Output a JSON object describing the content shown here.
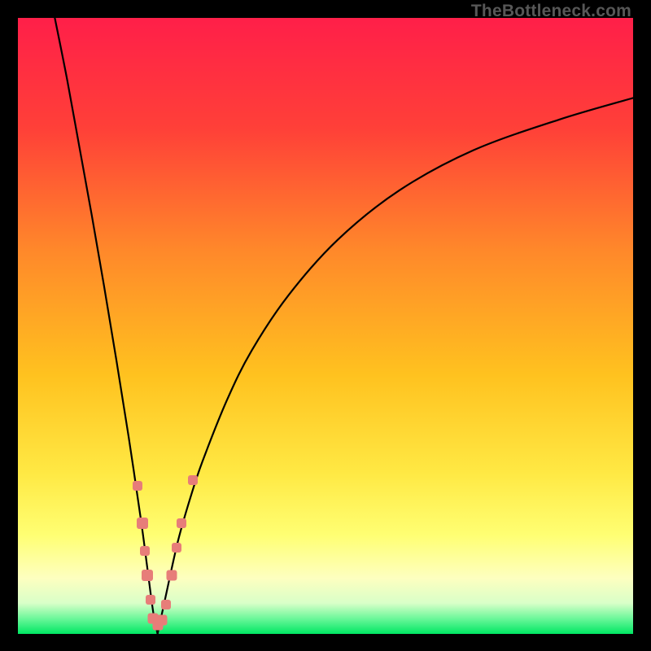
{
  "attribution": "TheBottleneck.com",
  "colors": {
    "top": "#ff1f49",
    "upper_mid": "#ff6a2a",
    "mid": "#ffcf1f",
    "lower_mid": "#ffff73",
    "pale": "#fbffd0",
    "green": "#00e763",
    "marker": "#e77d79",
    "curve": "#000000"
  },
  "chart_data": {
    "type": "line",
    "title": "",
    "xlabel": "",
    "ylabel": "",
    "xlim": [
      0,
      100
    ],
    "ylim": [
      0,
      100
    ],
    "series": [
      {
        "name": "left-curve",
        "x": [
          6,
          8,
          10,
          12,
          14,
          16,
          18,
          20,
          21,
          22,
          22.7
        ],
        "values": [
          100,
          90,
          79,
          68,
          56.5,
          44.5,
          32,
          18.5,
          11,
          3.5,
          0
        ]
      },
      {
        "name": "right-curve",
        "x": [
          22.7,
          24,
          26,
          28,
          30,
          34,
          38,
          44,
          52,
          62,
          74,
          88,
          100
        ],
        "values": [
          0,
          6,
          15,
          22,
          28,
          38,
          46,
          55,
          64,
          72,
          78.5,
          83.5,
          87
        ]
      }
    ],
    "markers": [
      {
        "x": 19.5,
        "y": 24,
        "size": 12
      },
      {
        "x": 20.2,
        "y": 18,
        "size": 14
      },
      {
        "x": 20.7,
        "y": 13.5,
        "size": 12
      },
      {
        "x": 21.0,
        "y": 9.5,
        "size": 14
      },
      {
        "x": 21.5,
        "y": 5.5,
        "size": 12
      },
      {
        "x": 22.0,
        "y": 2.5,
        "size": 13
      },
      {
        "x": 22.7,
        "y": 1.5,
        "size": 13
      },
      {
        "x": 23.4,
        "y": 2.2,
        "size": 13
      },
      {
        "x": 24.1,
        "y": 4.8,
        "size": 12
      },
      {
        "x": 25.0,
        "y": 9.5,
        "size": 13
      },
      {
        "x": 25.8,
        "y": 14,
        "size": 12
      },
      {
        "x": 26.6,
        "y": 18,
        "size": 12
      },
      {
        "x": 28.4,
        "y": 25,
        "size": 12
      }
    ]
  }
}
